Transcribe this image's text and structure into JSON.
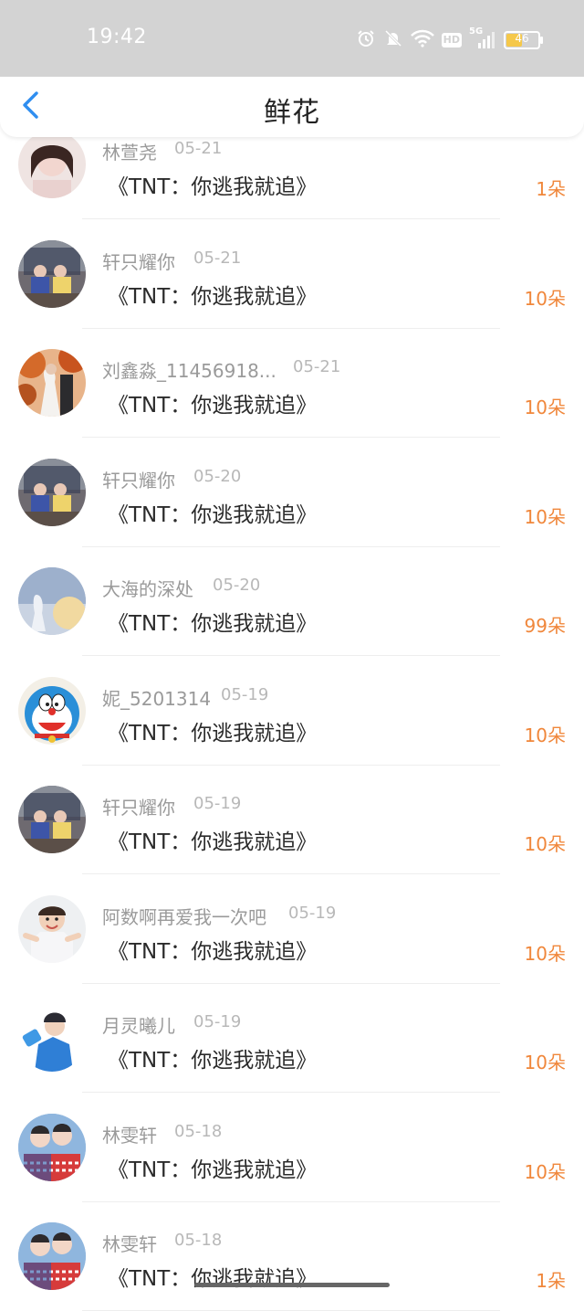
{
  "status_bar": {
    "time": "19:42",
    "network_badge": "HD",
    "signal_label": "5G",
    "battery_level": "46"
  },
  "header": {
    "title": "鲜花",
    "back_icon": "chevron-left-icon"
  },
  "colors": {
    "accent": "#2f8ef0",
    "count": "#f0873b",
    "status_bar_bg": "#d3d3d3"
  },
  "list": {
    "items": [
      {
        "user": "林萱尧",
        "date": "05-21",
        "work": "《TNT：你逃我就追》",
        "count": "1朵",
        "avatar": "girl-portrait"
      },
      {
        "user": "轩只耀你",
        "date": "05-21",
        "work": "《TNT：你逃我就追》",
        "count": "10朵",
        "avatar": "group-photo"
      },
      {
        "user": "刘鑫淼_11456918...",
        "date": "05-21",
        "work": "《TNT：你逃我就追》",
        "count": "10朵",
        "avatar": "autumn-couple"
      },
      {
        "user": "轩只耀你",
        "date": "05-20",
        "work": "《TNT：你逃我就追》",
        "count": "10朵",
        "avatar": "group-photo"
      },
      {
        "user": "大海的深处",
        "date": "05-20",
        "work": "《TNT：你逃我就追》",
        "count": "99朵",
        "avatar": "moon-figure"
      },
      {
        "user": "妮_5201314",
        "date": "05-19",
        "work": "《TNT：你逃我就追》",
        "count": "10朵",
        "avatar": "doraemon"
      },
      {
        "user": "轩只耀你",
        "date": "05-19",
        "work": "《TNT：你逃我就追》",
        "count": "10朵",
        "avatar": "group-photo"
      },
      {
        "user": "阿数啊再爱我一次吧",
        "date": "05-19",
        "work": "《TNT：你逃我就追》",
        "count": "10朵",
        "avatar": "baby"
      },
      {
        "user": "月灵曦儿",
        "date": "05-19",
        "work": "《TNT：你逃我就追》",
        "count": "10朵",
        "avatar": "boy-blue"
      },
      {
        "user": "林雯轩",
        "date": "05-18",
        "work": "《TNT：你逃我就追》",
        "count": "10朵",
        "avatar": "couple-sweater"
      },
      {
        "user": "林雯轩",
        "date": "05-18",
        "work": "《TNT：你逃我就追》",
        "count": "1朵",
        "avatar": "couple-sweater"
      }
    ]
  }
}
